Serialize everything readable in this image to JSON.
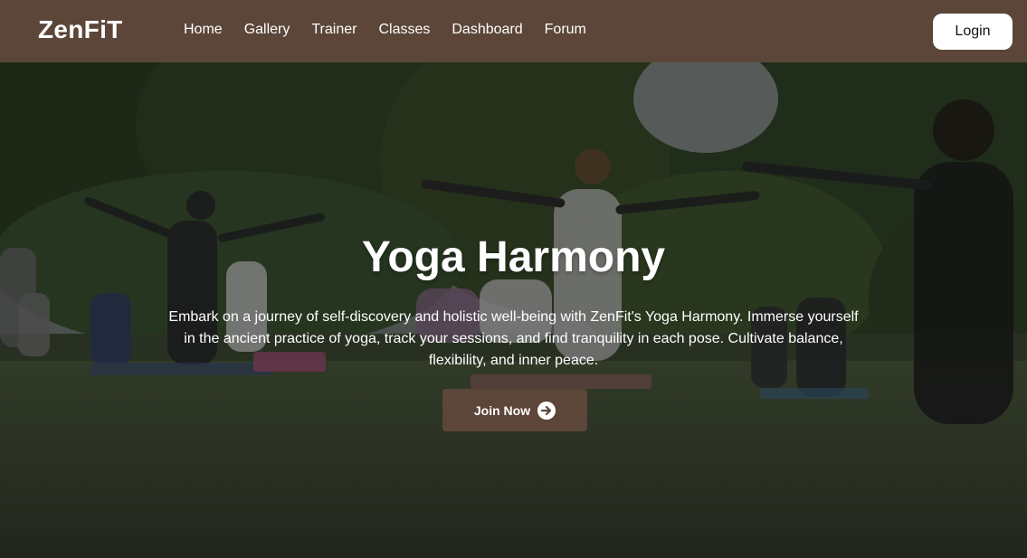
{
  "brand": {
    "logo_text": "ZenFiT",
    "nav_color": "#5c4639"
  },
  "nav": {
    "items": [
      {
        "label": "Home"
      },
      {
        "label": "Gallery"
      },
      {
        "label": "Trainer"
      },
      {
        "label": "Classes"
      },
      {
        "label": "Dashboard"
      },
      {
        "label": "Forum"
      }
    ],
    "login_label": "Login"
  },
  "hero": {
    "title": "Yoga Harmony",
    "description": "Embark on a journey of self-discovery and holistic well-being with ZenFit's Yoga Harmony. Immerse yourself in the ancient practice of yoga, track your sessions, and find tranquility in each pose. Cultivate balance, flexibility, and inner peace.",
    "cta_label": "Join Now",
    "cta_icon": "arrow-right-circle-icon",
    "background_image": "outdoor yoga class in park"
  }
}
